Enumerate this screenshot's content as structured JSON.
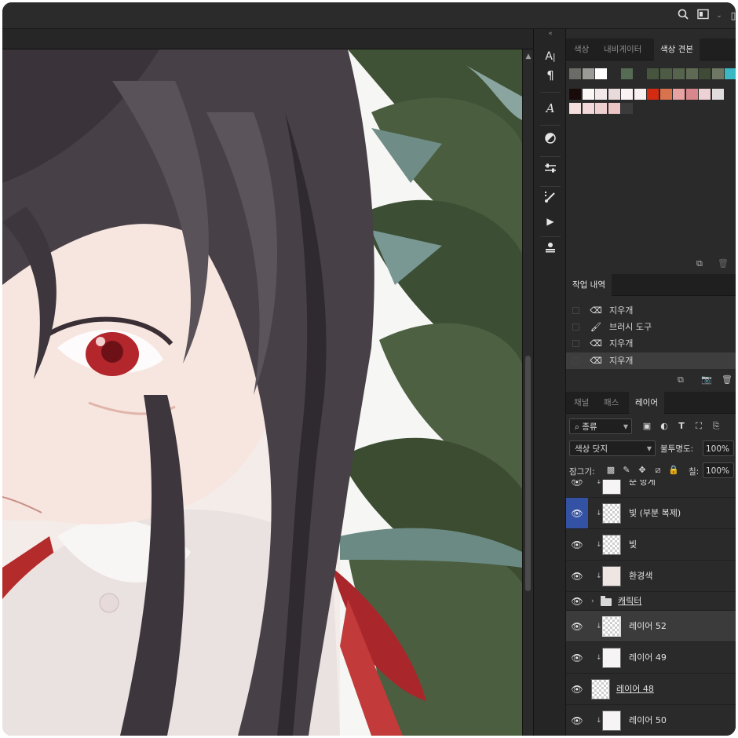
{
  "top_bar": {
    "search_icon": "search-icon",
    "workspace_icon": "workspace-icon"
  },
  "toolbar": {
    "tools": [
      "character-icon",
      "paragraph-icon",
      "glyphs-icon",
      "adjustments-icon",
      "properties-icon",
      "brush-settings-icon",
      "actions-icon",
      "libraries-icon"
    ],
    "character_glyph": "A|",
    "paragraph_glyph": "¶"
  },
  "swatches_panel": {
    "tabs": [
      "색상",
      "내비게이터",
      "색상 견본"
    ],
    "active_tab": "색상 견본",
    "row1": [
      "#6b6b68",
      "#9a9a96",
      "#ffffff",
      "#2a2a2a",
      "#556b54",
      "#2a2a2a",
      "#47553e",
      "#4d5b45",
      "#56634d",
      "#5e6a53",
      "#3f4a37",
      "#6e7763",
      "#3ab8c4"
    ],
    "row2": [
      "#1a0b0b",
      "#fbf7f7",
      "#f2eaea",
      "#e9dbdb",
      "#fbf3f3",
      "#f9f0f0",
      "#d42a12",
      "#d8734d",
      "#e8a2a2",
      "#d8878d",
      "#ecd1d5",
      "#e1dddd"
    ],
    "row3": [
      "#f5dede",
      "#f3d9d9",
      "#eed0d0",
      "#ebc4c4",
      "#3b3b3b"
    ]
  },
  "history_panel": {
    "tab": "작업 내역",
    "items": [
      {
        "label": "지우개",
        "icon": "eraser-icon"
      },
      {
        "label": "브러시 도구",
        "icon": "brush-icon"
      },
      {
        "label": "지우개",
        "icon": "eraser-icon"
      },
      {
        "label": "지우개",
        "icon": "eraser-icon"
      }
    ]
  },
  "layers_panel": {
    "tabs": [
      "채널",
      "패스",
      "레이어"
    ],
    "active_tab": "레이어",
    "filter_kind": "종류",
    "blend_mode": "색상 닷지",
    "opacity_label": "불투명도:",
    "opacity_value": "100%",
    "lock_label": "잠그기:",
    "fill_label": "칠:",
    "fill_value": "100%",
    "partial_layer_name": "순 방게",
    "layers": [
      {
        "name": "빛 (부분 복제)",
        "thumb": "checker",
        "selected_eye": true
      },
      {
        "name": "빛",
        "thumb": "checker"
      },
      {
        "name": "환경색",
        "thumb": "plain"
      },
      {
        "name": "캐릭터",
        "group": true
      },
      {
        "name": "레이어 52",
        "thumb": "checker",
        "selected": true
      },
      {
        "name": "레이어 49",
        "thumb": "plain"
      },
      {
        "name": "레이어 48",
        "thumb": "checker"
      },
      {
        "name": "레이어 50",
        "thumb": "plain"
      }
    ]
  }
}
